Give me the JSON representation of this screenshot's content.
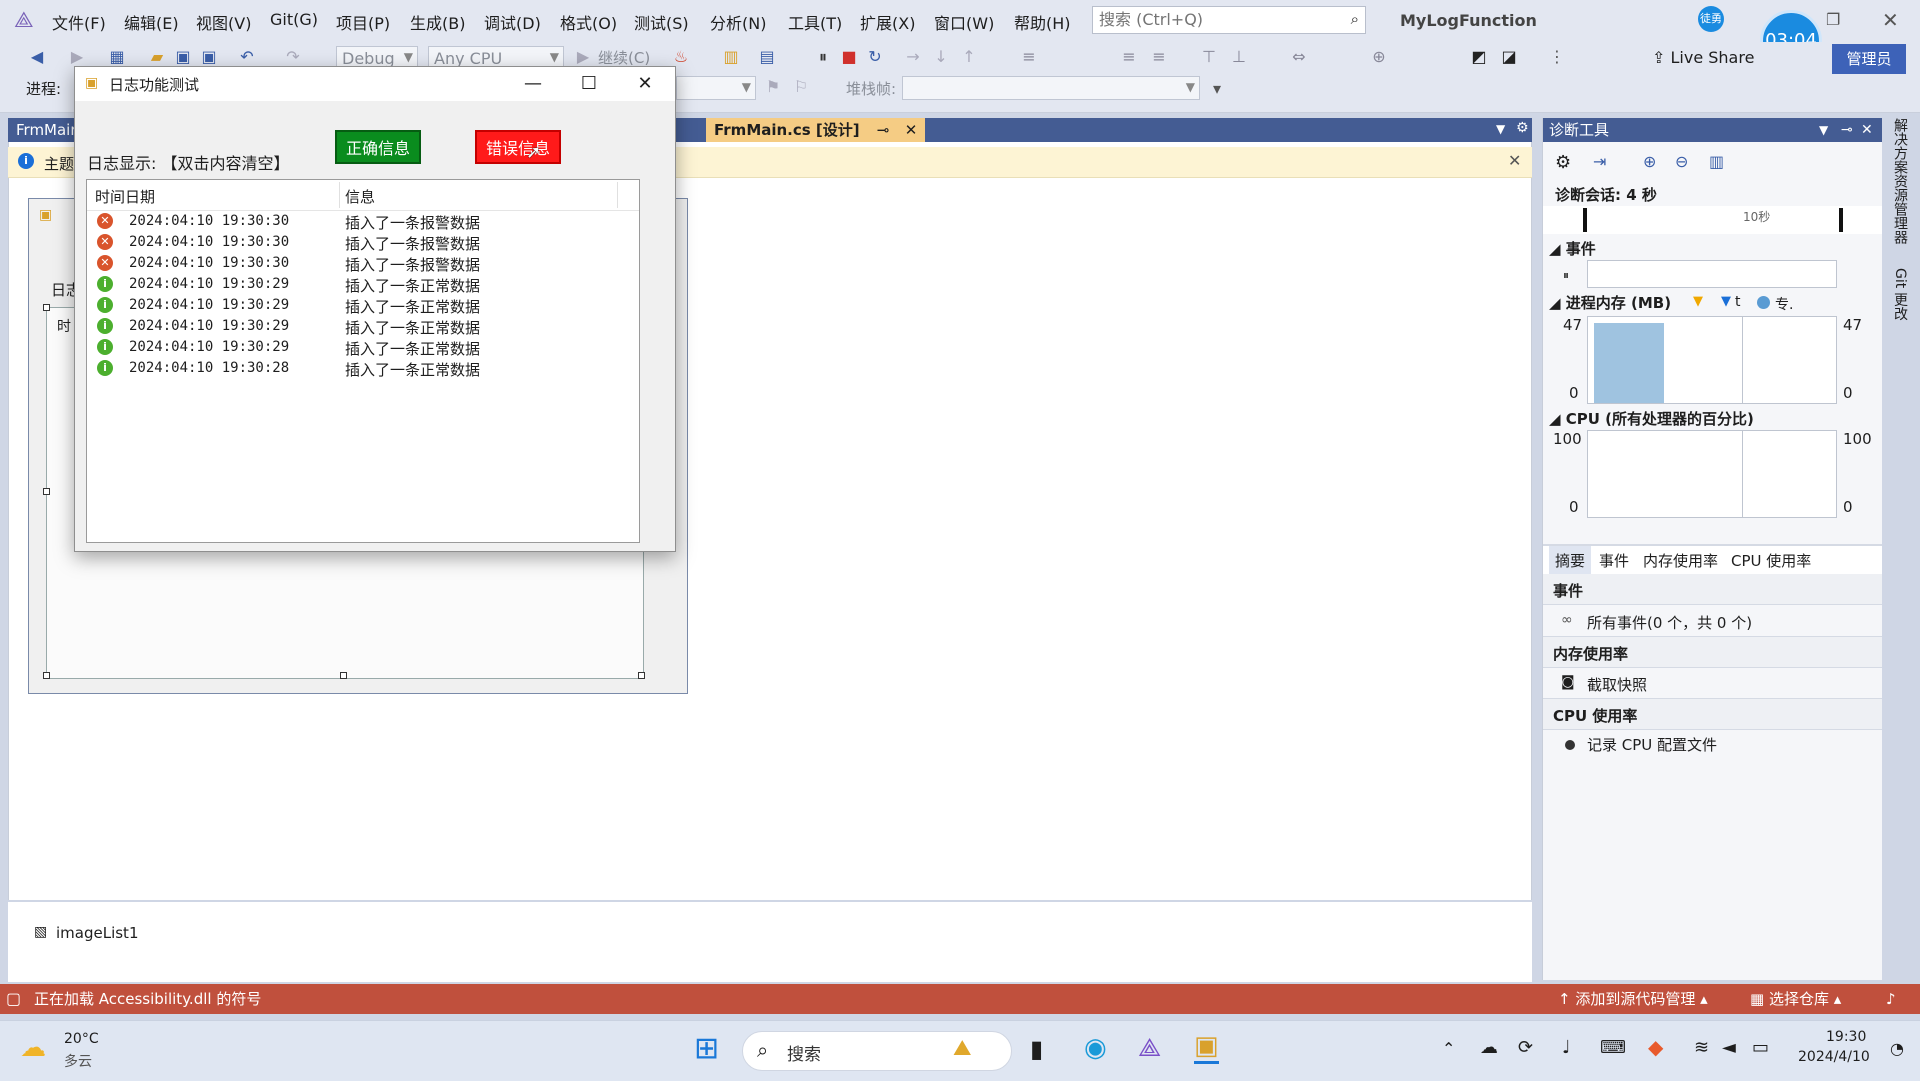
{
  "vs": {
    "menu": [
      "文件(F)",
      "编辑(E)",
      "视图(V)",
      "Git(G)",
      "项目(P)",
      "生成(B)",
      "调试(D)",
      "格式(O)",
      "测试(S)",
      "分析(N)",
      "工具(T)",
      "扩展(X)",
      "窗口(W)",
      "帮助(H)"
    ],
    "search_placeholder": "搜索 (Ctrl+Q)",
    "solution_name": "MyLogFunction",
    "user_badge": "徒勇",
    "timer": "03:04",
    "admin_label": "管理员",
    "live_share": "Live Share",
    "debug_config": "Debug",
    "platform": "Any CPU",
    "continue_label": "继续(C)",
    "process_label": "进程:",
    "stackframe_label": "堆栈帧:"
  },
  "tabs": {
    "left_tab": "FrmMain",
    "active_tab": "FrmMain.cs [设计]"
  },
  "infobar": {
    "text": "主题"
  },
  "designer": {
    "label_fragment": "日志",
    "column_fragment": "时",
    "tray_item": "imageList1"
  },
  "diagnostics": {
    "title": "诊断工具",
    "session": "诊断会话: 4 秒",
    "tick_label": "10秒",
    "events_header": "事件",
    "memory_header": "进程内存 (MB)",
    "memory_legend": [
      "t",
      "专."
    ],
    "memory_max": "47",
    "memory_min": "0",
    "cpu_header": "CPU (所有处理器的百分比)",
    "cpu_max": "100",
    "cpu_min": "0",
    "bottom_tabs": [
      "摘要",
      "事件",
      "内存使用率",
      "CPU 使用率"
    ],
    "events_section": "事件",
    "all_events": "所有事件(0 个，共 0 个)",
    "memory_section": "内存使用率",
    "snapshot": "截取快照",
    "cpu_section": "CPU 使用率",
    "record_cpu": "记录 CPU 配置文件",
    "colors": {
      "memory_fill": "#9fc3e0"
    }
  },
  "side_tabs": [
    "解决方案资源管理器",
    "Git 更改"
  ],
  "status": {
    "loading": "正在加载 Accessibility.dll 的符号",
    "source_control": "添加到源代码管理",
    "repo": "选择仓库"
  },
  "taskbar": {
    "temp": "20°C",
    "weather": "多云",
    "search": "搜索",
    "time": "19:30",
    "date": "2024/4/10"
  },
  "dialog": {
    "title": "日志功能测试",
    "log_label": "日志显示: 【双击内容清空】",
    "btn_ok": "正确信息",
    "btn_err": "错误信息",
    "col_time": "时间日期",
    "col_msg": "信息",
    "rows": [
      {
        "type": "error",
        "time": "2024:04:10 19:30:30",
        "msg": "插入了一条报警数据"
      },
      {
        "type": "error",
        "time": "2024:04:10 19:30:30",
        "msg": "插入了一条报警数据"
      },
      {
        "type": "error",
        "time": "2024:04:10 19:30:30",
        "msg": "插入了一条报警数据"
      },
      {
        "type": "info",
        "time": "2024:04:10 19:30:29",
        "msg": "插入了一条正常数据"
      },
      {
        "type": "info",
        "time": "2024:04:10 19:30:29",
        "msg": "插入了一条正常数据"
      },
      {
        "type": "info",
        "time": "2024:04:10 19:30:29",
        "msg": "插入了一条正常数据"
      },
      {
        "type": "info",
        "time": "2024:04:10 19:30:29",
        "msg": "插入了一条正常数据"
      },
      {
        "type": "info",
        "time": "2024:04:10 19:30:28",
        "msg": "插入了一条正常数据"
      }
    ],
    "colors": {
      "ok_button": "#0a8c1e",
      "error_button": "#ff1a1a",
      "error_icon": "#d9542c",
      "info_icon": "#4caf2e"
    }
  }
}
